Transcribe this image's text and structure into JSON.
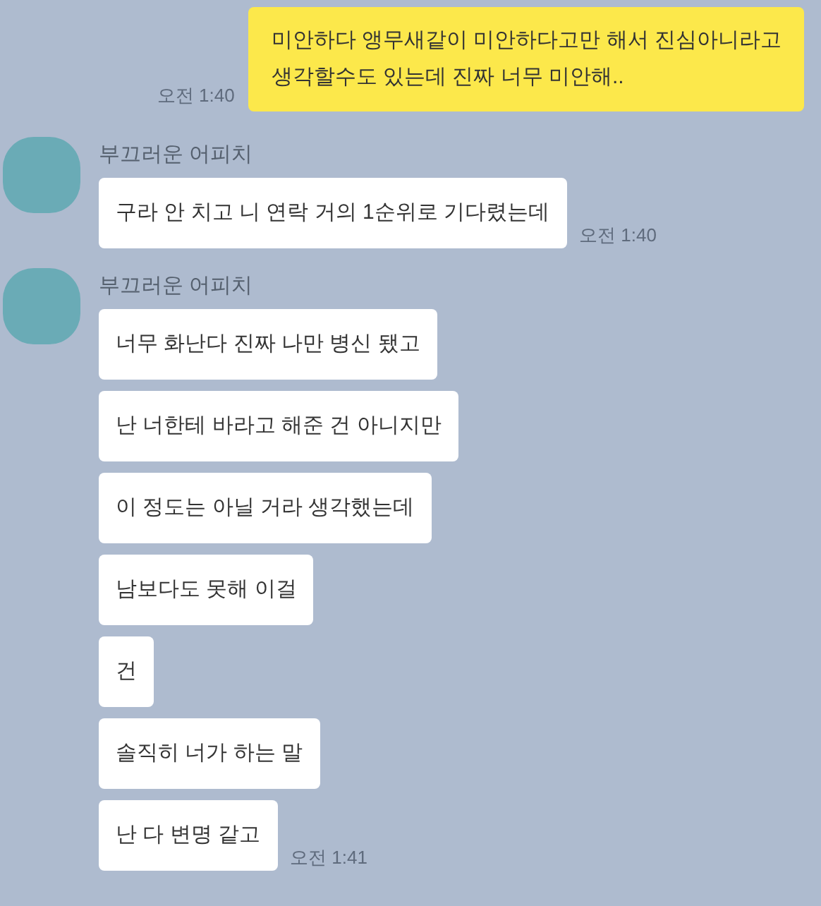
{
  "messages": [
    {
      "kind": "sent",
      "text": "미안하다 앵무새같이 미안하다고만 해서 진심아니라고\n생각할수도 있는데 진짜 너무 미안해..",
      "time": "오전 1:40"
    },
    {
      "kind": "received",
      "sender": "부끄러운 어피치",
      "bubbles": [
        "구라 안 치고 니 연락 거의 1순위로 기다렸는데"
      ],
      "time": "오전 1:40"
    },
    {
      "kind": "received",
      "sender": "부끄러운 어피치",
      "bubbles": [
        "너무 화난다 진짜 나만 병신 됐고",
        "난 너한테 바라고 해준 건 아니지만",
        "이 정도는 아닐 거라 생각했는데",
        "남보다도 못해 이걸",
        "건",
        "솔직히 너가 하는 말",
        "난 다 변명 같고"
      ],
      "time": "오전 1:41"
    }
  ]
}
